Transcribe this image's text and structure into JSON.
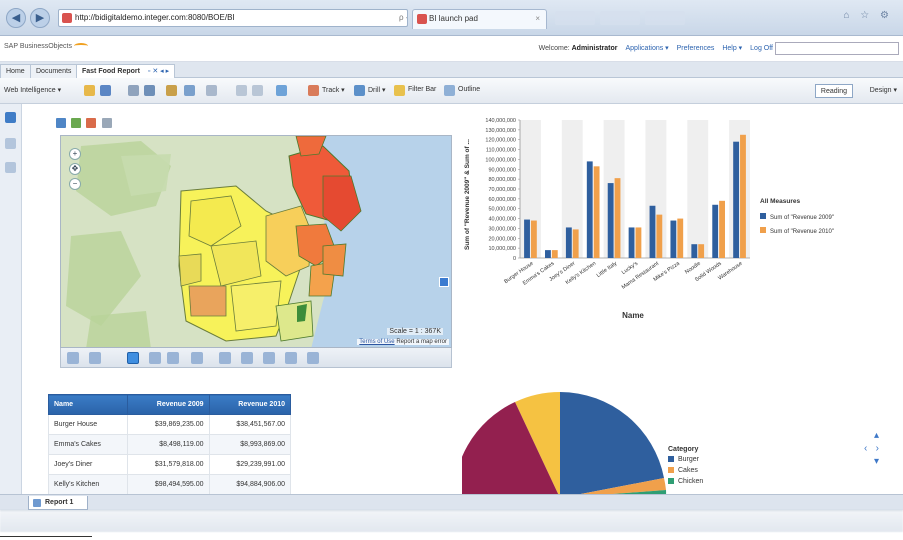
{
  "browser": {
    "url": "http://bidigitaldemo.integer.com:8080/BOE/BI",
    "address_tools": "ρ - ≣ C ✕",
    "tab_title": "BI launch pad"
  },
  "header": {
    "logo_prefix": "SAP BusinessObjects",
    "logo_brand": "Objects",
    "welcome_prefix": "Welcome:",
    "user": "Administrator",
    "links": [
      "Applications ▾",
      "Preferences",
      "Help ▾",
      "Log Off"
    ]
  },
  "doc_tabs": [
    "Home",
    "Documents",
    "Fast Food Report"
  ],
  "toolbar": {
    "app_menu": "Web Intelligence ▾",
    "track": "Track ▾",
    "drill": "Drill ▾",
    "filter_bar": "Filter Bar",
    "outline": "Outline",
    "reading": "Reading",
    "design": "Design ▾"
  },
  "map": {
    "scale": "Scale = 1 : 367K",
    "credit_terms": "Terms of Use",
    "credit_error": "Report a map error"
  },
  "bar_chart": {
    "y_label": "Sum of \"Revenue 2009\" & Sum of ...",
    "x_label": "Name",
    "legend_title": "All Measures",
    "colors": [
      "#2f5f9e",
      "#f0a04b"
    ],
    "chart_data": {
      "type": "bar",
      "categories": [
        "Burger House",
        "Emma's Cakes",
        "Joey's Diner",
        "Kelly's Kitchen",
        "Little Italy",
        "Lucky's",
        "Mama Restaurant",
        "Mike's Pizza",
        "Noodle",
        "Solid Woods",
        "Warehouse"
      ],
      "series": [
        {
          "name": "Sum of \"Revenue 2009\"",
          "values": [
            39000000,
            8000000,
            31000000,
            98000000,
            76000000,
            31000000,
            53000000,
            38000000,
            14000000,
            54000000,
            118000000
          ]
        },
        {
          "name": "Sum of \"Revenue 2010\"",
          "values": [
            38000000,
            8000000,
            29000000,
            93000000,
            81000000,
            31000000,
            44000000,
            40000000,
            14000000,
            58000000,
            125000000
          ]
        }
      ],
      "ylim": [
        0,
        140000000
      ],
      "yticks": [
        "0",
        "10,000,000",
        "20,000,000",
        "30,000,000",
        "40,000,000",
        "50,000,000",
        "60,000,000",
        "70,000,000",
        "80,000,000",
        "90,000,000",
        "100,000,000",
        "110,000,000",
        "120,000,000",
        "130,000,000",
        "140,000,000"
      ],
      "ytick_values": [
        0,
        10000000,
        20000000,
        30000000,
        40000000,
        50000000,
        60000000,
        70000000,
        80000000,
        90000000,
        100000000,
        110000000,
        120000000,
        130000000,
        140000000
      ],
      "legend": "right",
      "grid": true
    }
  },
  "table": {
    "headers": [
      "Name",
      "Revenue 2009",
      "Revenue 2010"
    ],
    "rows": [
      [
        "Burger House",
        "$39,869,235.00",
        "$38,451,567.00"
      ],
      [
        "Emma's Cakes",
        "$8,498,119.00",
        "$8,993,869.00"
      ],
      [
        "Joey's Diner",
        "$31,579,818.00",
        "$29,239,991.00"
      ],
      [
        "Kelly's Kitchen",
        "$98,494,595.00",
        "$94,884,906.00"
      ]
    ]
  },
  "pie": {
    "legend_title": "Category",
    "legend": [
      {
        "label": "Burger",
        "color": "#2f5f9e"
      },
      {
        "label": "Cakes",
        "color": "#f0a04b"
      },
      {
        "label": "Chicken",
        "color": "#2f9e74"
      }
    ],
    "chart_data": {
      "type": "pie",
      "slices": [
        {
          "label": "Burger",
          "color": "#2f5f9e"
        },
        {
          "label": "Cakes",
          "color": "#f0a04b"
        },
        {
          "label": "Chicken",
          "color": "#2f9e74"
        },
        {
          "color": "#f5c242"
        },
        {
          "color": "#93204f"
        }
      ]
    }
  },
  "report_tab": "Report 1"
}
